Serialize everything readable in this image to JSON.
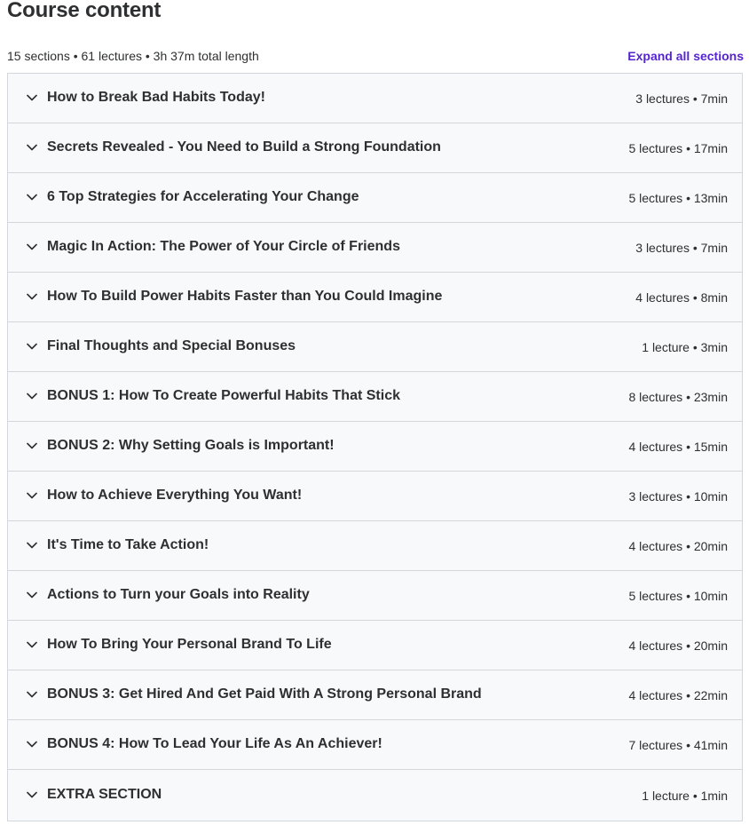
{
  "header": {
    "title": "Course content",
    "summary": "15 sections • 61 lectures • 3h 37m total length",
    "expand_all_label": "Expand all sections"
  },
  "colors": {
    "link": "#5624d0",
    "section_bg": "#f7f9fa",
    "border": "#d1d7dc",
    "text": "#2d2f31"
  },
  "chevron_icon": "chevron-down-icon",
  "sections": [
    {
      "title": "How to Break Bad Habits Today!",
      "meta": "3 lectures • 7min"
    },
    {
      "title": "Secrets Revealed - You Need to Build a Strong Foundation",
      "meta": "5 lectures • 17min"
    },
    {
      "title": "6 Top Strategies for Accelerating Your Change",
      "meta": "5 lectures • 13min"
    },
    {
      "title": "Magic In Action: The Power of Your Circle of Friends",
      "meta": "3 lectures • 7min"
    },
    {
      "title": "How To Build Power Habits Faster than You Could Imagine",
      "meta": "4 lectures • 8min"
    },
    {
      "title": "Final Thoughts and Special Bonuses",
      "meta": "1 lecture • 3min"
    },
    {
      "title": "BONUS 1: How To Create Powerful Habits That Stick",
      "meta": "8 lectures • 23min"
    },
    {
      "title": "BONUS 2: Why Setting Goals is Important!",
      "meta": "4 lectures • 15min"
    },
    {
      "title": "How to Achieve Everything You Want!",
      "meta": "3 lectures • 10min"
    },
    {
      "title": "It's Time to Take Action!",
      "meta": "4 lectures • 20min"
    },
    {
      "title": "Actions to Turn your Goals into Reality",
      "meta": "5 lectures • 10min"
    },
    {
      "title": "How To Bring Your Personal Brand To Life",
      "meta": "4 lectures • 20min"
    },
    {
      "title": "BONUS 3: Get Hired And Get Paid With A Strong Personal Brand",
      "meta": "4 lectures • 22min"
    },
    {
      "title": "BONUS 4: How To Lead Your Life As An Achiever!",
      "meta": "7 lectures • 41min"
    },
    {
      "title": "EXTRA SECTION",
      "meta": "1 lecture • 1min"
    }
  ]
}
